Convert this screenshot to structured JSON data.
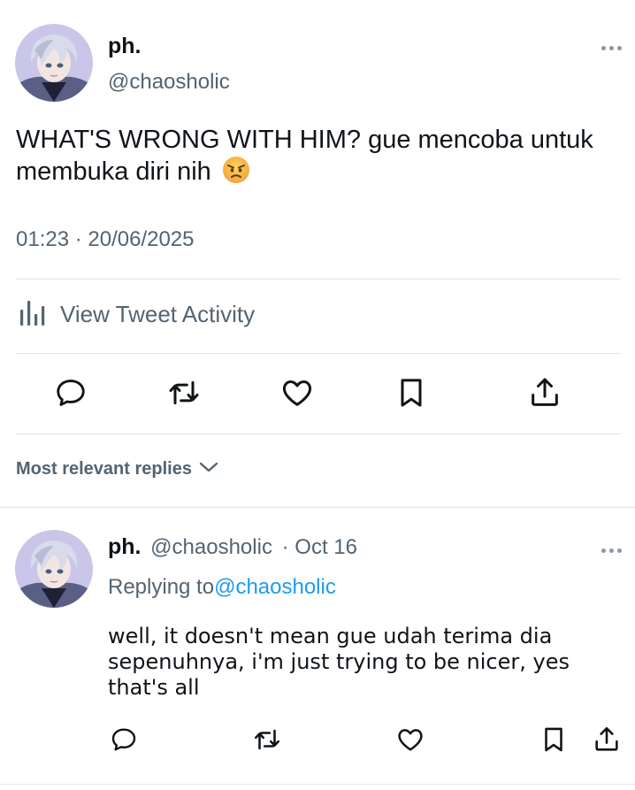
{
  "main_tweet": {
    "author_name": "ph.",
    "author_handle": "@chaosholic",
    "text": "WHAT'S WRONG WITH HIM? gue mencoba untuk membuka diri nih",
    "emoji": "angry-face",
    "timestamp": "01:23 · 20/06/2025"
  },
  "activity": {
    "label": "View Tweet Activity"
  },
  "actions": [
    "reply-icon",
    "retweet-icon",
    "like-icon",
    "bookmark-icon",
    "share-icon"
  ],
  "replies_filter": {
    "label": "Most relevant replies"
  },
  "reply": {
    "author_name": "ph.",
    "author_handle": "@chaosholic",
    "date": "· Oct 16",
    "replying_prefix": "Replying to",
    "replying_to": "@chaosholic",
    "text": "well, it doesn't mean gue udah terima dia sepenuhnya, i'm just trying to be nicer, yes that's all"
  },
  "colors": {
    "text": "#0f1419",
    "secondary": "#536471",
    "link": "#1d9bf0",
    "divider": "#e1e4e8"
  }
}
